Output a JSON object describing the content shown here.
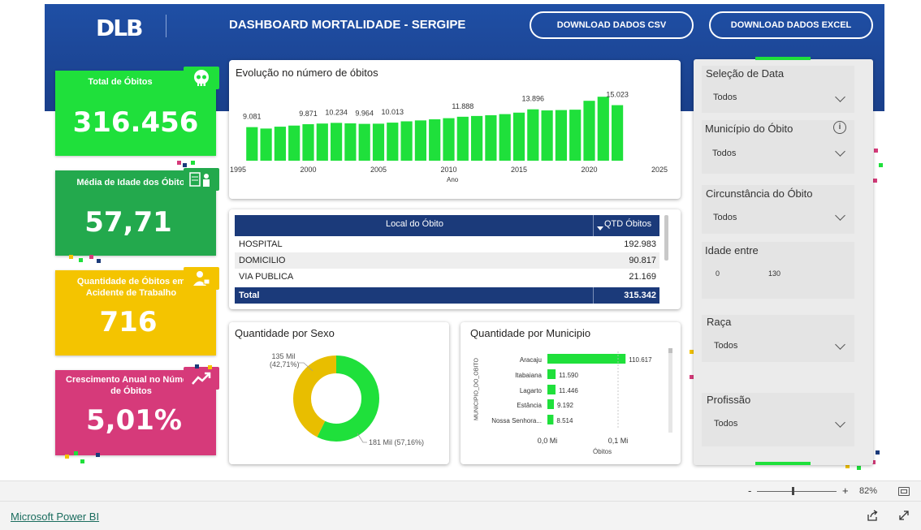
{
  "header": {
    "logo": "DLB",
    "title": "DASHBOARD MORTALIDADE - SERGIPE",
    "btn_csv": "DOWNLOAD DADOS CSV",
    "btn_excel": "DOWNLOAD DADOS EXCEL"
  },
  "kpis": {
    "total": {
      "label": "Total de Óbitos",
      "value": "316.456",
      "color": "#1fe03b"
    },
    "media": {
      "label": "Média de Idade dos Óbitos",
      "value": "57,71",
      "color": "#23a94d"
    },
    "acidente": {
      "label": "Quantidade de Óbitos em Acidente de Trabalho",
      "value": "716",
      "color": "#f4c400"
    },
    "crescimento": {
      "label": "Crescimento Anual no Número de Óbitos",
      "value": "5,01%",
      "color": "#d63a7a"
    }
  },
  "evolucao": {
    "title": "Evolução no número de óbitos",
    "xlabel": "Ano",
    "x_ticks": [
      "1995",
      "2000",
      "2005",
      "2010",
      "2015",
      "2020",
      "2025"
    ]
  },
  "chart_data": [
    {
      "type": "bar",
      "title": "Evolução no número de óbitos",
      "xlabel": "Ano",
      "ylabel": "",
      "x": [
        1996,
        1997,
        1998,
        1999,
        2000,
        2001,
        2002,
        2003,
        2004,
        2005,
        2006,
        2007,
        2008,
        2009,
        2010,
        2011,
        2012,
        2013,
        2014,
        2015,
        2016,
        2017,
        2018,
        2019,
        2020,
        2021,
        2022
      ],
      "values": [
        9081,
        8700,
        9200,
        9500,
        9871,
        10050,
        10234,
        10100,
        9964,
        10013,
        10300,
        10650,
        10900,
        11200,
        11500,
        11888,
        12100,
        12300,
        12600,
        13000,
        13896,
        13600,
        13700,
        13800,
        16200,
        17300,
        15023
      ],
      "data_labels": {
        "1996": "9.081",
        "2000": "9.871",
        "2002": "10.234",
        "2004": "9.964",
        "2006": "10.013",
        "2011": "11.888",
        "2016": "13.896",
        "2022": "15.023"
      },
      "xlim": [
        1995,
        2025
      ],
      "color": "#1fe03b"
    },
    {
      "type": "pie",
      "title": "Quantidade por Sexo",
      "series": [
        {
          "label": "181 Mil (57,16%)",
          "value": 57.16,
          "color": "#1fe03b"
        },
        {
          "label": "135 Mil (42,71%)",
          "value": 42.71,
          "color": "#e8be00"
        }
      ]
    },
    {
      "type": "bar",
      "title": "Quantidade por Municipio",
      "xlabel": "Óbitos",
      "ylabel": "MUNICIPIO_DO_OBITO",
      "categories": [
        "Aracaju",
        "Itabaiana",
        "Lagarto",
        "Estância",
        "Nossa Senhora..."
      ],
      "values": [
        110617,
        11590,
        11446,
        9192,
        8514
      ],
      "value_labels": [
        "110.617",
        "11.590",
        "11.446",
        "9.192",
        "8.514"
      ],
      "x_ticks": [
        "0,0 Mi",
        "0,1 Mi"
      ],
      "color": "#1fe03b"
    }
  ],
  "table": {
    "col1": "Local do Óbito",
    "col2": "QTD Óbitos",
    "rows": [
      {
        "local": "HOSPITAL",
        "qtd": "192.983"
      },
      {
        "local": "DOMICILIO",
        "qtd": "90.817"
      },
      {
        "local": "VIA PUBLICA",
        "qtd": "21.169"
      }
    ],
    "total_label": "Total",
    "total_value": "315.342"
  },
  "sexo": {
    "title": "Quantidade por Sexo",
    "label_f_1": "135 Mil",
    "label_f_2": "(42,71%)",
    "label_m": "181 Mil (57,16%)"
  },
  "municipio": {
    "title": "Quantidade por Municipio",
    "ylabel": "MUNICIPIO_DO_OBITO",
    "xlabel": "Óbitos"
  },
  "slicers": {
    "data": {
      "label": "Seleção de Data",
      "value": "Todos"
    },
    "municipio": {
      "label": "Município do Óbito",
      "value": "Todos"
    },
    "circunstancia": {
      "label": "Circunstância do Óbito",
      "value": "Todos"
    },
    "idade": {
      "label": "Idade entre",
      "min": "0",
      "max": "130"
    },
    "raca": {
      "label": "Raça",
      "value": "Todos"
    },
    "profissao": {
      "label": "Profissão",
      "value": "Todos"
    }
  },
  "zoom": {
    "minus": "-",
    "plus": "+",
    "level": "82%",
    "fraction": 0.45
  },
  "footer": {
    "brand": "Microsoft Power BI"
  },
  "icons": [
    "skull-icon",
    "id-card-icon",
    "worker-icon",
    "trend-up-icon",
    "info-icon",
    "fit-page-icon",
    "share-icon",
    "expand-icon"
  ]
}
